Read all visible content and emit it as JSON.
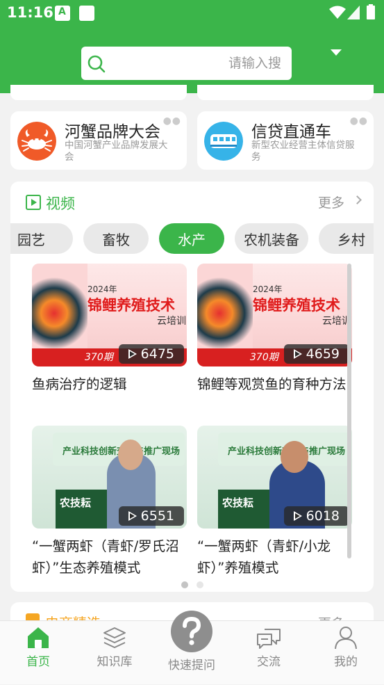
{
  "status_bar": {
    "time": "11:16"
  },
  "search": {
    "placeholder": "请输入搜"
  },
  "promo_cards": [
    {
      "title": "河蟹品牌大会",
      "subtitle": "中国河蟹产业品牌发展大会",
      "icon": "crab-icon"
    },
    {
      "title": "信贷直通车",
      "subtitle": "新型农业经营主体信贷服务",
      "icon": "train-icon"
    }
  ],
  "video_section": {
    "title": "视频",
    "more": "更多",
    "tabs": [
      "园艺",
      "畜牧",
      "水产",
      "农机装备",
      "乡村"
    ],
    "active_tab": "水产",
    "videos": [
      {
        "title": "鱼病治疗的逻辑",
        "views": "6475",
        "thumb_year": "2024年",
        "thumb_title": "锦鲤养殖技术",
        "thumb_sub": "云培训",
        "thumb_issue": "370期"
      },
      {
        "title": "锦鲤等观赏鱼的育种方法",
        "views": "4659",
        "thumb_year": "2024年",
        "thumb_title": "锦鲤养殖技术",
        "thumb_sub": "云培训",
        "thumb_issue": "370期"
      },
      {
        "title": "“一蟹两虾（青虾/罗氏沼虾）”生态养殖模式",
        "views": "6551",
        "thumb_banner": "产业科技创新交流与推广现场",
        "thumb_sign": "农技耘"
      },
      {
        "title": "“一蟹两虾（青虾/小龙虾）”养殖模式",
        "views": "6018",
        "thumb_banner": "产业科技创新交流与推广现场",
        "thumb_sign": "农技耘"
      }
    ]
  },
  "next_section": {
    "title": "电商精选",
    "more": "更多"
  },
  "bottom_nav": {
    "home": "首页",
    "knowledge": "知识库",
    "ask": "快速提问",
    "chat": "交流",
    "mine": "我的"
  },
  "colors": {
    "brand_green": "#3bb54a",
    "grey_text": "#888888"
  }
}
